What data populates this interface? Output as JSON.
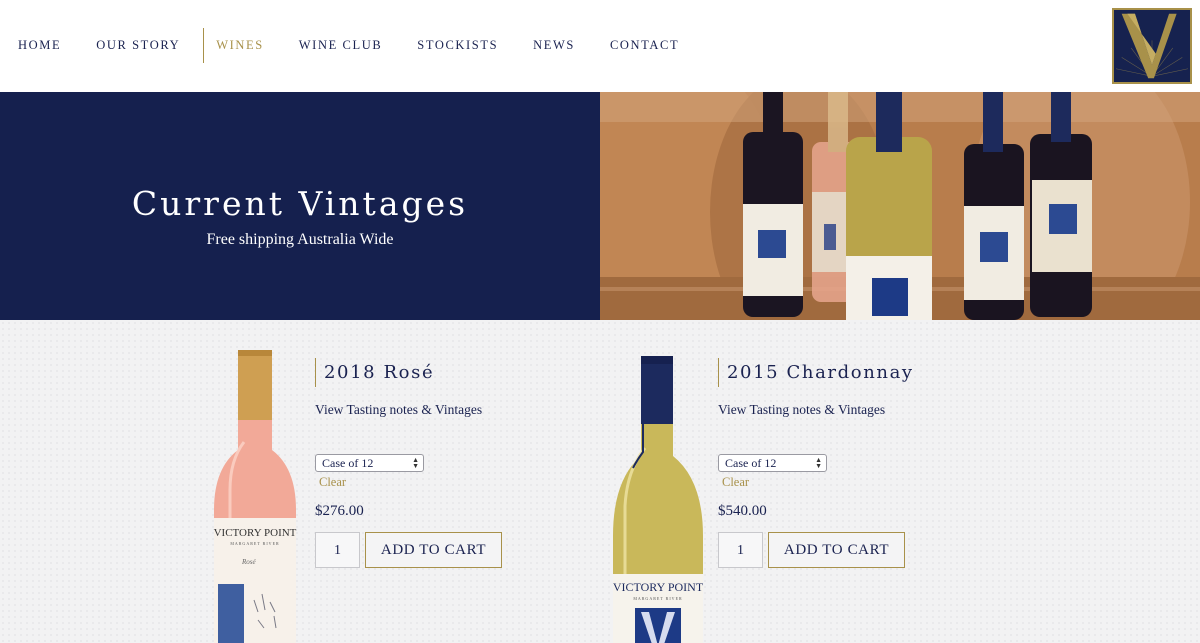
{
  "nav": {
    "items": [
      {
        "label": "HOME",
        "active": false
      },
      {
        "label": "OUR STORY",
        "active": false
      },
      {
        "label": "WINES",
        "active": true
      },
      {
        "label": "WINE CLUB",
        "active": false
      },
      {
        "label": "STOCKISTS",
        "active": false
      },
      {
        "label": "NEWS",
        "active": false
      },
      {
        "label": "CONTACT",
        "active": false
      }
    ]
  },
  "logo": {
    "icon": "victory-point-v-logo-icon"
  },
  "hero": {
    "title": "Current Vintages",
    "subtitle": "Free shipping Australia Wide",
    "image": "wine-bottles-on-barrel-photo"
  },
  "products": [
    {
      "title": "2018 Rosé",
      "tasting_link": "View Tasting notes & Vintages",
      "variant": "Case of 12",
      "clear": "Clear",
      "price": "$276.00",
      "quantity": "1",
      "add_to_cart": "ADD TO CART",
      "bottle_label": {
        "brand": "VICTORY POINT",
        "region": "MARGARET RIVER",
        "name": "Rosé"
      }
    },
    {
      "title": "2015 Chardonnay",
      "tasting_link": "View Tasting notes & Vintages",
      "variant": "Case of 12",
      "clear": "Clear",
      "price": "$540.00",
      "quantity": "1",
      "add_to_cart": "ADD TO CART",
      "bottle_label": {
        "brand": "VICTORY POINT",
        "region": "MARGARET RIVER"
      }
    }
  ],
  "colors": {
    "navy": "#15204e",
    "gold": "#a8914a",
    "background": "#f2f2f3"
  }
}
